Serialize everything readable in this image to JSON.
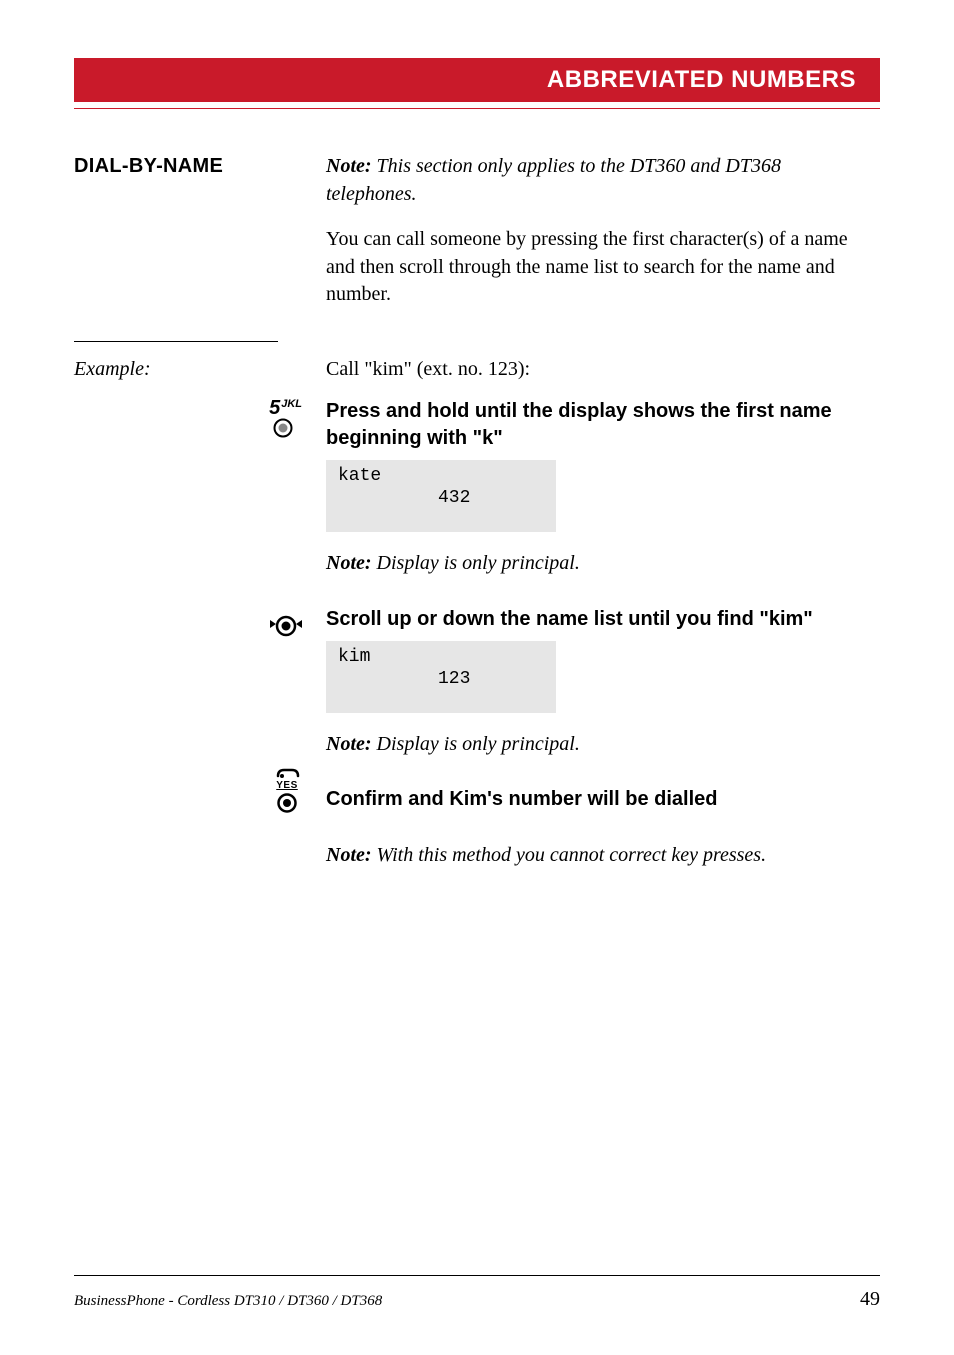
{
  "header": {
    "title": "ABBREVIATED NUMBERS"
  },
  "section": {
    "heading": "DIAL-BY-NAME",
    "note_label": "Note:",
    "note_text": " This section only applies to the DT360 and DT368 telephones.",
    "body": "You can call someone by pressing the first character(s) of a name and then scroll through the name list to search for the name and number."
  },
  "example": {
    "label": "Example:",
    "intro": "Call \"kim\" (ext. no. 123):"
  },
  "step1": {
    "key_sup": "JKL",
    "key_num": "5",
    "title": "Press and hold until the display shows the first name beginning with \"k\"",
    "display_name": "kate",
    "display_num": "432",
    "note_label": "Note:",
    "note_text": " Display is only principal."
  },
  "step2": {
    "title": "Scroll up or down the name list until you find \"kim\"",
    "display_name": "kim",
    "display_num": "123",
    "note_label": "Note:",
    "note_text": " Display is only principal."
  },
  "step3": {
    "yes_label": "YES",
    "title": "Confirm and Kim's number will be dialled",
    "note_label": "Note:",
    "note_text": " With this method you cannot correct key presses."
  },
  "footer": {
    "text": "BusinessPhone - Cordless DT310 / DT360 / DT368",
    "page": "49"
  }
}
